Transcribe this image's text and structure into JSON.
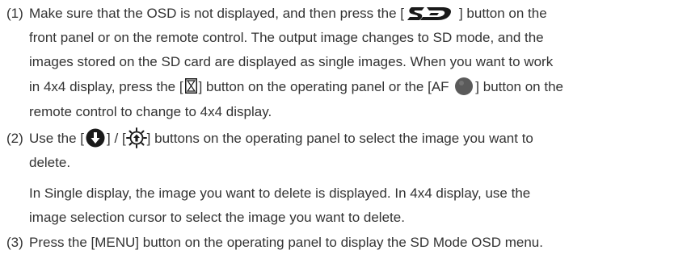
{
  "steps": [
    {
      "number": "(1)",
      "l1a": "Make sure that the OSD is not displayed, and then press the [",
      "l1b": "] button on the",
      "l2": "front panel or on the remote control. The output image changes to SD mode, and the",
      "l3": "images stored on the SD card are displayed as single images. When you want to work",
      "l4a": "in 4x4 display, press the [",
      "l4b": "] button on the operating panel or the [AF",
      "l4c": "] button on the",
      "l5": "remote control to change to 4x4 display."
    },
    {
      "number": "(2)",
      "l1a": "Use the [",
      "l1b": "] / [",
      "l1c": "] buttons on the operating panel to select the image you want to",
      "l2": "delete.",
      "l3": "In Single display, the image you want to delete is displayed. In 4x4 display, use the",
      "l4": "image selection cursor to select the image you want to delete."
    },
    {
      "number": "(3)",
      "l1": "Press the [MENU] button on the operating panel to display the SD Mode OSD menu."
    }
  ],
  "icons": {
    "sd": "sd-logo-icon",
    "hourglass": "hourglass-icon",
    "af": "af-circle-icon",
    "down": "down-arrow-icon",
    "focus": "focus-sun-icon"
  },
  "colors": {
    "text": "#333333",
    "icon": "#1a1a1a",
    "circle": "#5a5a5a"
  }
}
